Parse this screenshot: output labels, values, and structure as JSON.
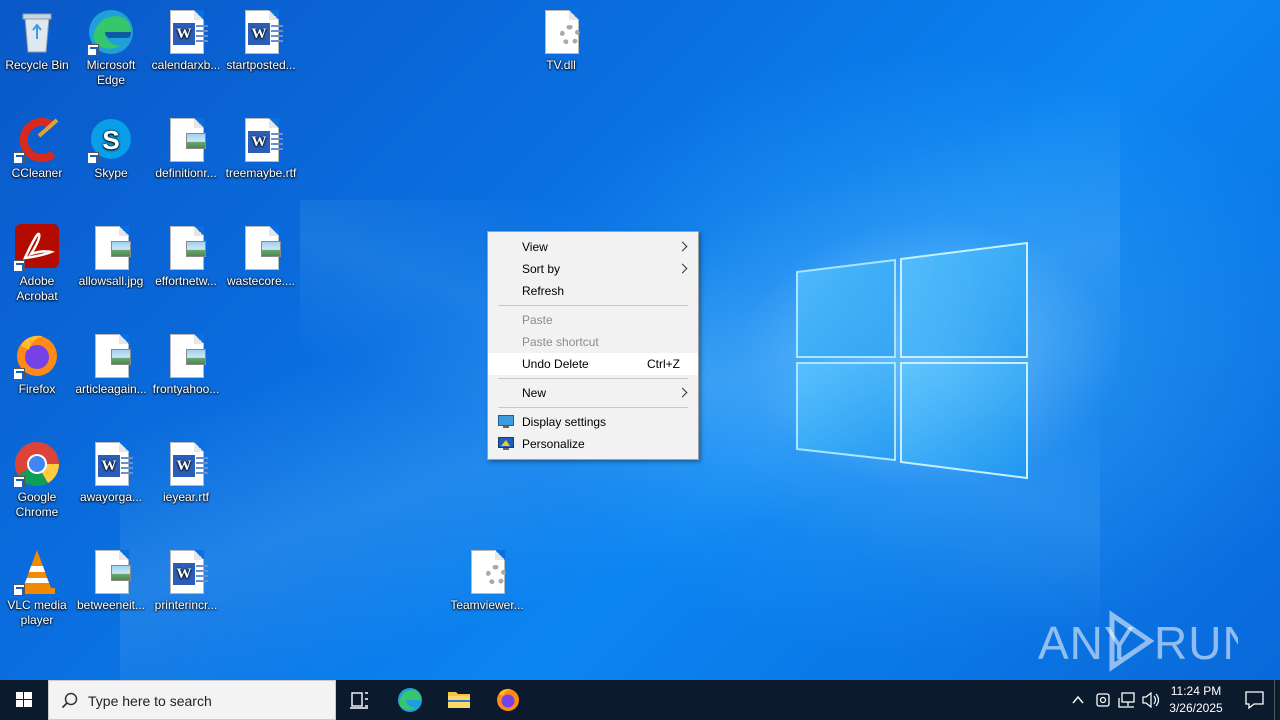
{
  "desktop": {
    "icons": [
      {
        "label": "Recycle Bin"
      },
      {
        "label": "Microsoft Edge"
      },
      {
        "label": "calendarxb..."
      },
      {
        "label": "startposted..."
      },
      {
        "label": "TV.dll"
      },
      {
        "label": "CCleaner"
      },
      {
        "label": "Skype"
      },
      {
        "label": "definitionr..."
      },
      {
        "label": "treemaybe.rtf"
      },
      {
        "label": "Adobe Acrobat"
      },
      {
        "label": "allowsall.jpg"
      },
      {
        "label": "effortnetw..."
      },
      {
        "label": "wastecore...."
      },
      {
        "label": "Firefox"
      },
      {
        "label": "articleagain..."
      },
      {
        "label": "frontyahoo..."
      },
      {
        "label": "Google Chrome"
      },
      {
        "label": "awayorga..."
      },
      {
        "label": "ieyear.rtf"
      },
      {
        "label": "VLC media player"
      },
      {
        "label": "betweeneit..."
      },
      {
        "label": "printerincr..."
      },
      {
        "label": "Teamviewer..."
      }
    ]
  },
  "context_menu": {
    "view": "View",
    "sort_by": "Sort by",
    "refresh": "Refresh",
    "paste": "Paste",
    "paste_shortcut": "Paste shortcut",
    "undo_delete": "Undo Delete",
    "undo_shortcut": "Ctrl+Z",
    "new": "New",
    "display_settings": "Display settings",
    "personalize": "Personalize"
  },
  "taskbar": {
    "search_placeholder": "Type here to search",
    "time": "11:24 PM",
    "date": "3/26/2025"
  },
  "watermark": {
    "text_left": "ANY",
    "text_right": "RUN"
  },
  "colors": {
    "desktop_blue": "#0a6fe0",
    "taskbar": "#0b1a2c",
    "menu_bg": "#f2f2f2"
  }
}
